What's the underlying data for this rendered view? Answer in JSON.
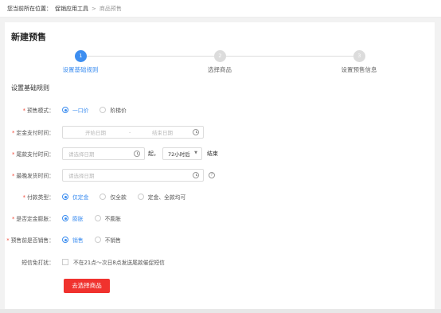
{
  "breadcrumb": {
    "lead": "您当前所在位置：",
    "items": [
      "促销应用工具",
      "商品预售"
    ],
    "separator": ">"
  },
  "page_title": "新建预售",
  "steps": [
    {
      "number": "1",
      "label": "设置基础规则",
      "state": "active"
    },
    {
      "number": "2",
      "label": "选择商品",
      "state": "todo"
    },
    {
      "number": "3",
      "label": "设置预售信息",
      "state": "todo"
    }
  ],
  "section_title": "设置基础规则",
  "form": {
    "presale_mode": {
      "label": "预售模式：",
      "options": [
        "一口价",
        "阶梯价"
      ],
      "selected": "一口价"
    },
    "deposit_time": {
      "label": "定金支付时间：",
      "start_placeholder": "开始日期",
      "range_sep": "-",
      "end_placeholder": "结束日期"
    },
    "balance_time": {
      "label": "尾款支付时间：",
      "placeholder": "请选择日期",
      "suffix": "起，",
      "duration_value": "72小时后",
      "end_text": "结束"
    },
    "latest_ship": {
      "label": "最晚发货时间：",
      "placeholder": "请选择日期"
    },
    "payment_type": {
      "label": "付款类型：",
      "options": [
        "仅定金",
        "仅全款",
        "定金、全款均可"
      ],
      "selected": "仅定金"
    },
    "deposit_expand": {
      "label": "是否定金膨胀：",
      "options": [
        "膨胀",
        "不膨胀"
      ],
      "selected": "膨胀"
    },
    "presale_before_sale": {
      "label": "预售前是否销售：",
      "options": [
        "销售",
        "不销售"
      ],
      "selected": "销售"
    },
    "sms_dnd": {
      "label": "短信免打扰：",
      "checkbox_text": "不在21点～次日8点发送尾款催促短信",
      "checked": false
    }
  },
  "submit_label": "去选择商品",
  "colors": {
    "accent": "#3d8ef0",
    "primary_button": "#f0322e",
    "required_star": "#f04a3a"
  }
}
